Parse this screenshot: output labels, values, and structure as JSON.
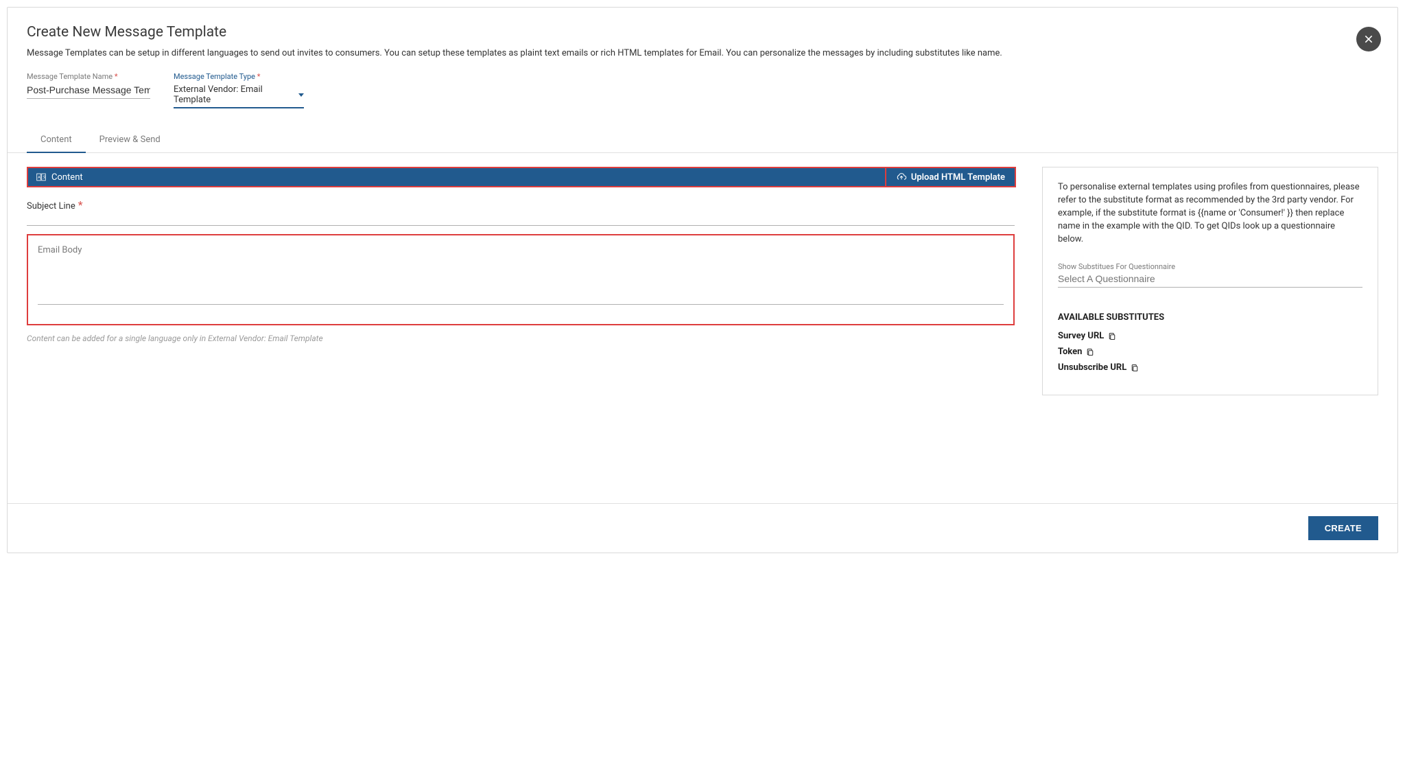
{
  "header": {
    "title": "Create New Message Template",
    "close_label": "Close"
  },
  "intro": "Message Templates can be setup in different languages to send out invites to consumers. You can setup these templates as plaint text emails or rich HTML templates for Email. You can personalize the messages by including substitutes like name.",
  "form": {
    "name_label": "Message Template Name",
    "name_value": "Post-Purchase Message Template",
    "type_label": "Message Template Type",
    "type_value": "External Vendor: Email Template"
  },
  "tabs": {
    "content": "Content",
    "preview": "Preview & Send"
  },
  "content_panel": {
    "bar_label": "Content",
    "upload_label": "Upload HTML Template",
    "subject_label": "Subject Line",
    "subject_value": "",
    "email_body_label": "Email Body",
    "email_body_value": "",
    "helper": "Content can be added for a single language only in External Vendor: Email Template"
  },
  "right_panel": {
    "description": "To personalise external templates using profiles from questionnaires, please refer to the substitute format as recommended by the 3rd party vendor. For example, if the substitute format is {{name or 'Consumer!' }} then replace name in the example with the QID. To get QIDs look up a questionnaire below.",
    "sub_label": "Show Substitues For Questionnaire",
    "sub_placeholder": "Select A Questionnaire",
    "available_title": "AVAILABLE SUBSTITUTES",
    "substitutes": {
      "survey_url": "Survey URL",
      "token": "Token",
      "unsubscribe_url": "Unsubscribe URL"
    }
  },
  "footer": {
    "create_label": "CREATE"
  }
}
